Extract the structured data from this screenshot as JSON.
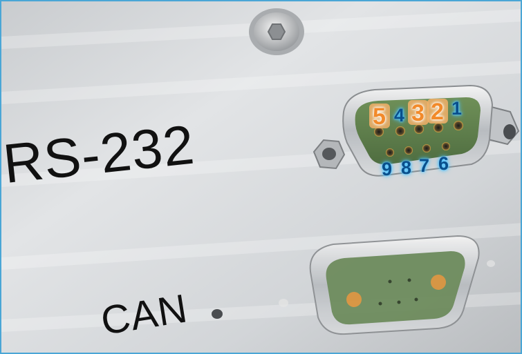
{
  "panel": {
    "labels": {
      "rs232": "RS-232",
      "can": "CAN"
    }
  },
  "pins": {
    "p1": "1",
    "p2": "2",
    "p3": "3",
    "p4": "4",
    "p5": "5",
    "p6": "6",
    "p7": "7",
    "p8": "8",
    "p9": "9"
  },
  "colors": {
    "frame_border": "#4aa6d6",
    "signal_pin_highlight": "#f28a2a",
    "other_pin_glow": "#4cc2ff",
    "connector_insert": "#5f7f4e"
  }
}
